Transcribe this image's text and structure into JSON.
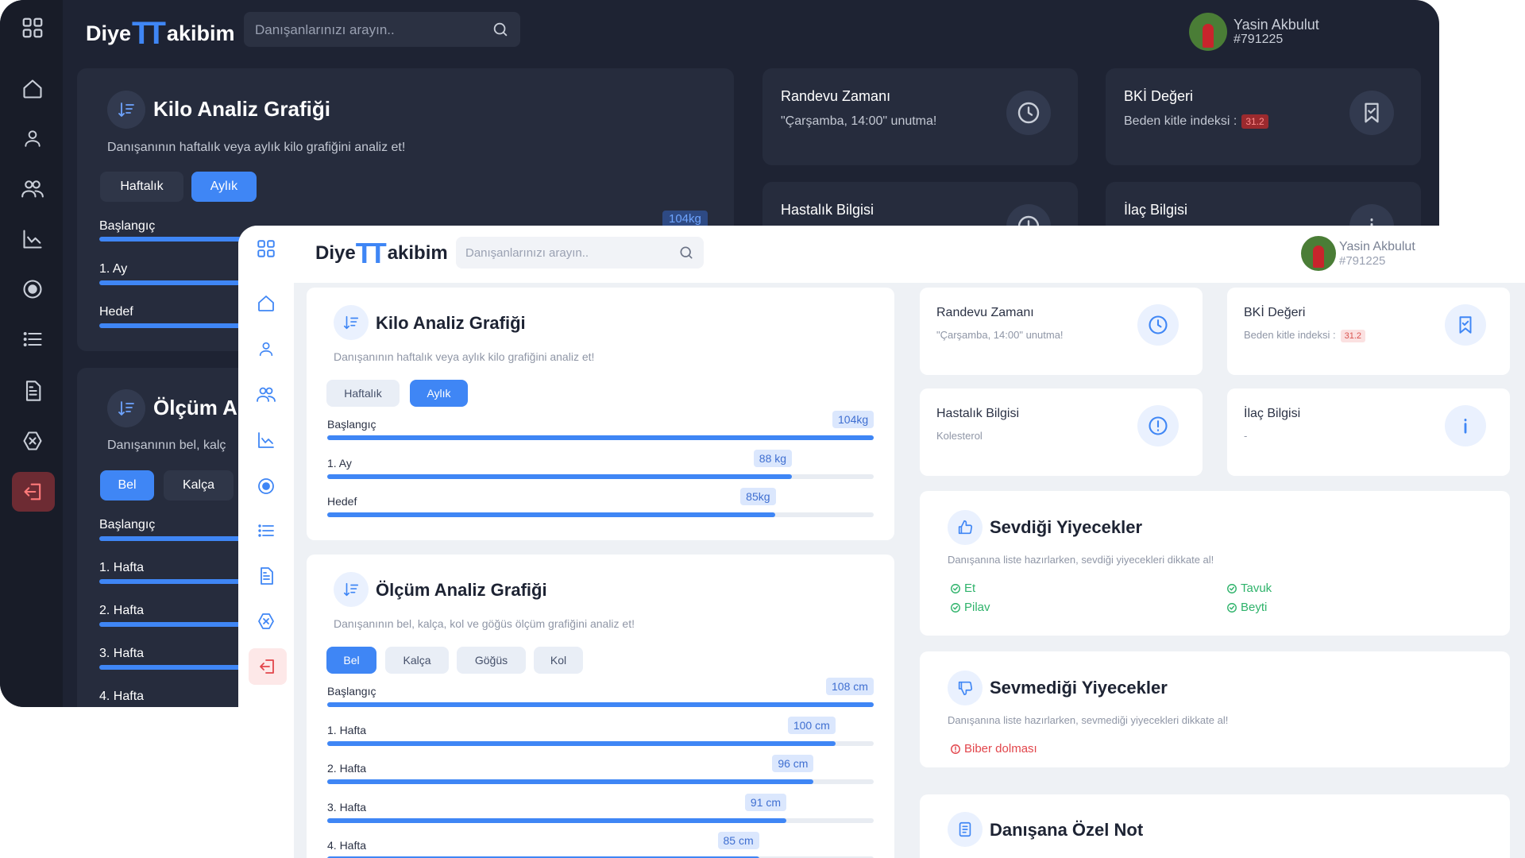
{
  "app": {
    "logo_prefix": "Diye",
    "logo_mark": "TT",
    "logo_suffix": "akibim",
    "search_placeholder": "Danışanlarınızı arayın..",
    "user_name": "Yasin Akbulut",
    "user_id": "#791225"
  },
  "sidebar_icons": [
    "grid-icon",
    "home-icon",
    "user-icon",
    "users-icon",
    "chart-line-icon",
    "target-icon",
    "list-icon",
    "document-icon",
    "close-box-icon",
    "logout-icon"
  ],
  "weight_panel": {
    "title": "Kilo Analiz Grafiği",
    "subtitle": "Danışanının haftalık veya aylık kilo grafiğini analiz et!",
    "tabs": [
      "Haftalık",
      "Aylık"
    ],
    "active_tab": "Aylık",
    "rows": [
      {
        "label": "Başlangıç",
        "value_label": "104kg",
        "fill": 1.0
      },
      {
        "label": "1. Ay",
        "value_label": "88 kg",
        "fill": 0.85
      },
      {
        "label": "Hedef",
        "value_label": "85kg",
        "fill": 0.82
      }
    ]
  },
  "measure_panel": {
    "title": "Ölçüm Analiz Grafiği",
    "dark_title_visible": "Ölçüm A",
    "subtitle": "Danışanının bel, kalça, kol ve göğüs ölçüm grafiğini analiz et!",
    "dark_subtitle_visible": "Danışanının bel, kalç",
    "tabs": [
      "Bel",
      "Kalça",
      "Göğüs",
      "Kol"
    ],
    "active_tab": "Bel",
    "rows": [
      {
        "label": "Başlangıç",
        "value_label": "108 cm",
        "fill": 1.0
      },
      {
        "label": "1. Hafta",
        "value_label": "100 cm",
        "fill": 0.93
      },
      {
        "label": "2. Hafta",
        "value_label": "96 cm",
        "fill": 0.89
      },
      {
        "label": "3. Hafta",
        "value_label": "91 cm",
        "fill": 0.84
      },
      {
        "label": "4. Hafta",
        "value_label": "85 cm",
        "fill": 0.79
      }
    ]
  },
  "cards": {
    "appointment": {
      "title": "Randevu Zamanı",
      "text": "\"Çarşamba, 14:00\" unutma!"
    },
    "bmi": {
      "title": "BKİ Değeri",
      "text": "Beden kitle indeksi :",
      "value": "31.2"
    },
    "disease": {
      "title": "Hastalık Bilgisi",
      "text": "Kolesterol"
    },
    "medicine": {
      "title": "İlaç Bilgisi",
      "text": "-"
    }
  },
  "liked_foods": {
    "title": "Sevdiği Yiyecekler",
    "subtitle": "Danışanına liste hazırlarken, sevdiği yiyecekleri dikkate al!",
    "items": [
      "Et",
      "Tavuk",
      "Pilav",
      "Beyti"
    ]
  },
  "disliked_foods": {
    "title": "Sevmediği Yiyecekler",
    "subtitle": "Danışanına liste hazırlarken, sevmediği yiyecekleri dikkate al!",
    "items": [
      "Biber dolması"
    ]
  },
  "note_panel": {
    "title": "Danışana Özel Not"
  },
  "colors": {
    "accent": "#3f86f5",
    "dark_bg": "#1e2333",
    "light_bg": "#eef1f5",
    "good": "#2fb36b",
    "bad": "#e2454b"
  }
}
